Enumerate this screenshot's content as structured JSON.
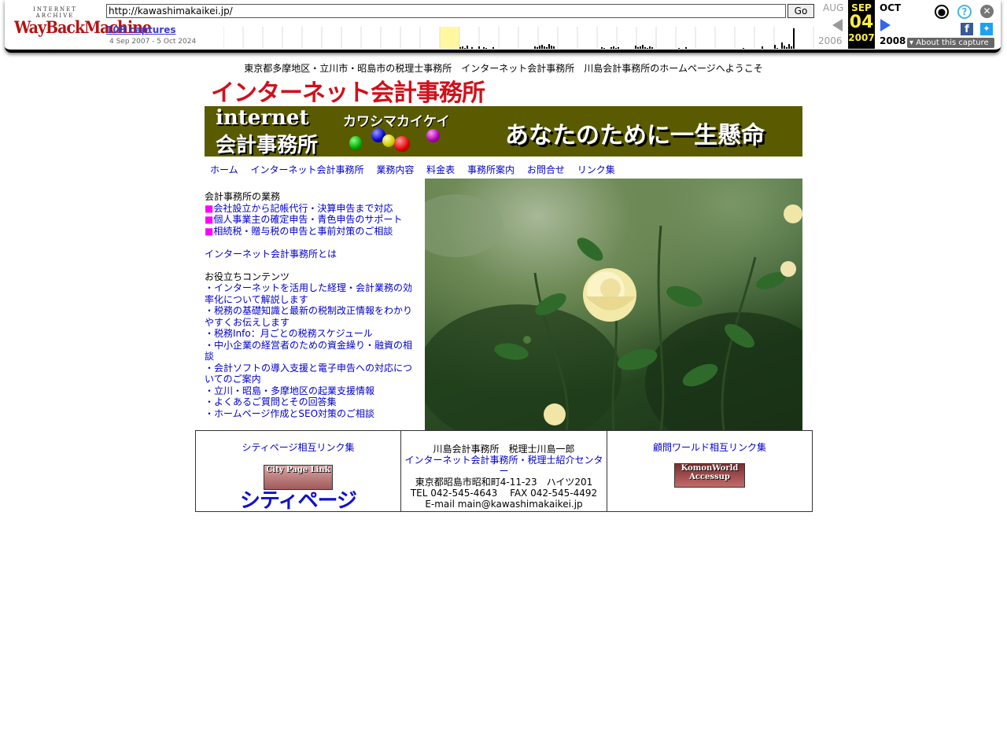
{
  "wayback": {
    "logo_small": "INTERNET ARCHIVE",
    "logo_main": "WayBackMachine",
    "url": "http://kawashimakaikei.jp/",
    "go_label": "Go",
    "captures_label": "108 captures",
    "date_range": "4 Sep 2007 - 5 Oct 2024",
    "prev_month": "AUG",
    "prev_year": "2006",
    "cur_month": "SEP",
    "cur_day": "04",
    "cur_year": "2007",
    "next_month": "OCT",
    "next_year": "2008",
    "about_label": "About this capture",
    "colors": {
      "current_bg": "#000000",
      "current_text": "#ffef3b",
      "highlight": "#fff8a0"
    }
  },
  "page": {
    "tagline": "東京都多摩地区・立川市・昭島市の税理士事務所　インターネット会計事務所　川島会計事務所のホームページへようこそ",
    "logo_text": "インターネット会計事務所",
    "banner": {
      "line1": "internet",
      "line2": "会計事務所",
      "katakana": "カワシマカイケイ",
      "slogan": "あなたのために一生懸命"
    },
    "nav": [
      "ホーム",
      "インターネット会計事務所",
      "業務内容",
      "料金表",
      "事務所案内",
      "お問合せ",
      "リンク集"
    ],
    "left": {
      "section1_title": "会計事務所の業務",
      "section1_items": [
        "会社設立から記帳代行・決算申告まで対応",
        "個人事業主の確定申告・青色申告のサポート",
        "相続税・贈与税の申告と事前対策のご相談"
      ],
      "single_link": "インターネット会計事務所とは",
      "section2_title": "お役立ちコンテンツ",
      "section2_items": [
        "・インターネットを活用した経理・会計業務の効率化について解説します",
        "・税務の基礎知識と最新の税制改正情報をわかりやすくお伝えします",
        "・税務Info：月ごとの税務スケジュール",
        "・中小企業の経営者のための資金繰り・融資の相談",
        "・会計ソフトの導入支援と電子申告への対応についてのご案内",
        "・立川・昭島・多摩地区の起業支援情報",
        "・よくあるご質問とその回答集",
        "・ホームページ作成とSEO対策のご相談"
      ]
    },
    "footer": {
      "left_link": "シティページ相互リンク集",
      "city_badge": "City Page Link",
      "city_text": "シティページ",
      "office_name": "川島会計事務所　税理士川島一郎",
      "office_link": "インターネット会計事務所・税理士紹介センター",
      "address": "東京都昭島市昭和町4-11-23　ハイツ201",
      "phone": "TEL 042-545-4643　 FAX 042-545-4492",
      "email": "E-mail main@kawashimakaikei.jp",
      "right_link": "顧問ワールド相互リンク集",
      "komon_badge": "KomonWorld Accessup"
    }
  }
}
